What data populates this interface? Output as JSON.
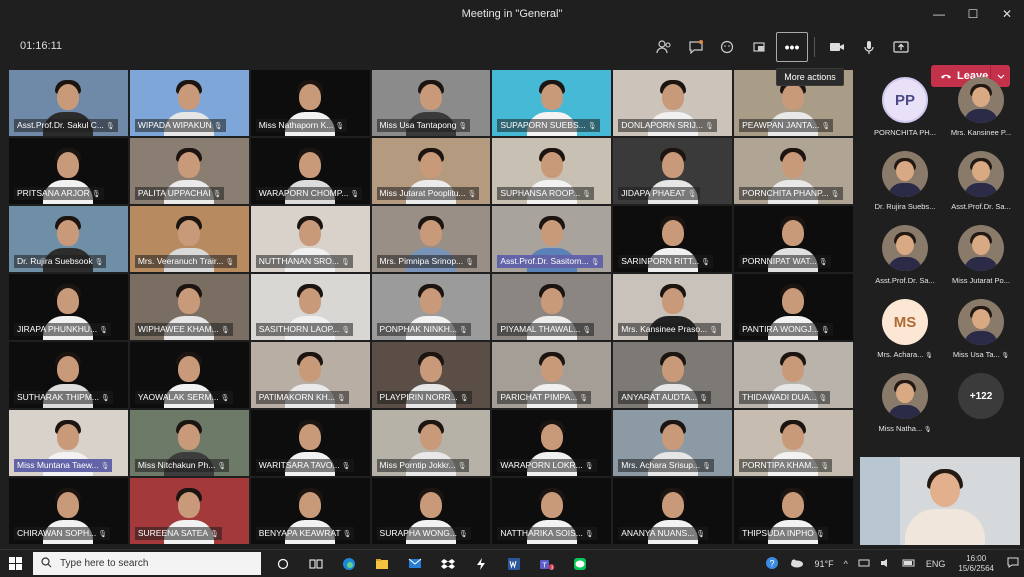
{
  "window": {
    "title": "Meeting in \"General\"",
    "minimize": "—",
    "maximize": "☐",
    "close": "✕"
  },
  "toolbar": {
    "timer": "01:16:11",
    "more_icon": "•••",
    "more_tooltip": "More actions",
    "leave_label": "Leave",
    "icons": [
      "participants-icon",
      "chat-icon",
      "reactions-icon",
      "share-tray-icon",
      "more-actions-icon",
      "camera-icon",
      "mic-icon",
      "share-icon"
    ]
  },
  "participants": [
    {
      "name": "Asst.Prof.Dr. Sakul C...",
      "bg": "#6f8aa8",
      "shirt": "#2b2b2b"
    },
    {
      "name": "WIPADA WIPAKUN",
      "bg": "#7fa6d8",
      "shirt": "#e6e6e6"
    },
    {
      "name": "Miss Nathaporn K...",
      "bg": "#0d0d0d",
      "shirt": "#f2f2f2"
    },
    {
      "name": "Miss Usa Tantapong",
      "bg": "#8b8b8b",
      "shirt": "#3a3a3a"
    },
    {
      "name": "SUPAPORN SUEBS...",
      "bg": "#46b9d6",
      "shirt": "#f3f3f3"
    },
    {
      "name": "DONLAPORN SRIJ...",
      "bg": "#ccc3bb",
      "shirt": "#f0f0f0"
    },
    {
      "name": "PEAWPAN JANTA...",
      "bg": "#aa9d88",
      "shirt": "#e8e8e8"
    },
    {
      "name": "PRITSANA ARJOR",
      "bg": "#0d0d0d",
      "shirt": "#f2f2f2"
    },
    {
      "name": "PALITA UPPACHAI",
      "bg": "#8a7e73",
      "shirt": "#eaeaea"
    },
    {
      "name": "WARAPORN CHOMP...",
      "bg": "#0d0d0d",
      "shirt": "#dcdcdc"
    },
    {
      "name": "Miss Jutarat Pooplitu...",
      "bg": "#b49a7f",
      "shirt": "#ececec"
    },
    {
      "name": "SUPHANSA ROOP...",
      "bg": "#c8c0b3",
      "shirt": "#f2f2f2"
    },
    {
      "name": "JIDAPA PHAEAT",
      "bg": "#3a3a3a",
      "shirt": "#e6e6e6"
    },
    {
      "name": "PORNCHITA PHANP...",
      "bg": "#b0a594",
      "shirt": "#e8e8e8"
    },
    {
      "name": "Dr. Rujira Suebsook",
      "bg": "#6e8fa6",
      "shirt": "#2d2d2d"
    },
    {
      "name": "Mrs. Veeranuch Trair...",
      "bg": "#b78b5f",
      "shirt": "#d9d9d9"
    },
    {
      "name": "NUTTHANAN SRO...",
      "bg": "#d8d2cb",
      "shirt": "#f0f0f0"
    },
    {
      "name": "Mrs. Pimnipa Srinop...",
      "bg": "#9a8f86",
      "shirt": "#7a93b8"
    },
    {
      "name": "Asst.Prof.Dr. Sasitorn...",
      "bg": "#a9a39e",
      "shirt": "#5a82b8",
      "selected": true
    },
    {
      "name": "SARINPORN RITT...",
      "bg": "#0d0d0d",
      "shirt": "#f0f0f0"
    },
    {
      "name": "PORNNIPAT WAT...",
      "bg": "#0d0d0d",
      "shirt": "#e0e0e0"
    },
    {
      "name": "JIRAPA PHUNKHU...",
      "bg": "#0d0d0d",
      "shirt": "#f2f2f2"
    },
    {
      "name": "WIPHAWEE KHAM...",
      "bg": "#7a6e62",
      "shirt": "#e6e6e6"
    },
    {
      "name": "SASITHORN LAOP...",
      "bg": "#d9d7d3",
      "shirt": "#f0f0f0"
    },
    {
      "name": "PONPHAK NINKH...",
      "bg": "#9b9b9b",
      "shirt": "#f2f2f2"
    },
    {
      "name": "PIYAMAL THAWAL...",
      "bg": "#8b8682",
      "shirt": "#ececec"
    },
    {
      "name": "Mrs. Kansinee Praso...",
      "bg": "#c9c2ba",
      "shirt": "#222222"
    },
    {
      "name": "PANTIRA WONGJ...",
      "bg": "#0d0d0d",
      "shirt": "#f2f2f2"
    },
    {
      "name": "SUTHARAK THIPM...",
      "bg": "#0d0d0d",
      "shirt": "#dddddd"
    },
    {
      "name": "YAOWALAK SERM...",
      "bg": "#0d0d0d",
      "shirt": "#f2f2f2"
    },
    {
      "name": "PATIMAKORN KH...",
      "bg": "#b8aea3",
      "shirt": "#eaeaea"
    },
    {
      "name": "PLAYPIRIN NORR...",
      "bg": "#5a4e46",
      "shirt": "#e6e6e6"
    },
    {
      "name": "PARICHAT PIMPA...",
      "bg": "#a59e96",
      "shirt": "#f0f0f0"
    },
    {
      "name": "ANYARAT AUDTA...",
      "bg": "#7d7a76",
      "shirt": "#e6e6e6"
    },
    {
      "name": "THIDAWADI DUA...",
      "bg": "#b9b3ab",
      "shirt": "#e6e6e6"
    },
    {
      "name": "Miss Muntana Taew...",
      "bg": "#d8d2cb",
      "shirt": "#f2f2f2",
      "selected": true
    },
    {
      "name": "Miss Nitchakun Ph...",
      "bg": "#6d7a68",
      "shirt": "#3c3c3c"
    },
    {
      "name": "WARITSARA TAVO...",
      "bg": "#0d0d0d",
      "shirt": "#f2f2f2"
    },
    {
      "name": "Miss Porntip Jokkr...",
      "bg": "#b7b2a7",
      "shirt": "#e8e8e8"
    },
    {
      "name": "WARAPORN LOKR...",
      "bg": "#0d0d0d",
      "shirt": "#f0f0f0"
    },
    {
      "name": "Mrs. Achara Srisup...",
      "bg": "#8b9aa5",
      "shirt": "#e6e6e6"
    },
    {
      "name": "PORNTIPA KHAM...",
      "bg": "#c6bdb0",
      "shirt": "#f2f2f2"
    },
    {
      "name": "CHIRAWAN SOPH...",
      "bg": "#0d0d0d",
      "shirt": "#f2f2f2"
    },
    {
      "name": "SUREENA SATEA",
      "bg": "#a3393b",
      "shirt": "#f2f2f2"
    },
    {
      "name": "BENYAPA KEAWRAT",
      "bg": "#0d0d0d",
      "shirt": "#f2f2f2"
    },
    {
      "name": "SURAPHA WONG...",
      "bg": "#0d0d0d",
      "shirt": "#f2f2f2"
    },
    {
      "name": "NATTHARIKA SOIS...",
      "bg": "#0d0d0d",
      "shirt": "#f2f2f2"
    },
    {
      "name": "ANANYA NUANS...",
      "bg": "#0d0d0d",
      "shirt": "#f2f2f2"
    },
    {
      "name": "THIPSUDA INPHO",
      "bg": "#0d0d0d",
      "shirt": "#f2f2f2"
    }
  ],
  "side_panel": [
    {
      "label": "PORNCHITA PH...",
      "type": "initials",
      "initials": "PP",
      "muted": false
    },
    {
      "label": "Mrs. Kansinee P...",
      "type": "photo",
      "muted": false
    },
    {
      "label": "Dr. Rujira Suebs...",
      "type": "photo",
      "muted": false
    },
    {
      "label": "Asst.Prof.Dr. Sa...",
      "type": "photo",
      "muted": false
    },
    {
      "label": "Asst.Prof.Dr. Sa...",
      "type": "photo",
      "muted": false
    },
    {
      "label": "Miss Jutarat Po...",
      "type": "photo",
      "muted": false
    },
    {
      "label": "Mrs. Achara...",
      "type": "ms",
      "initials": "MS",
      "muted": true
    },
    {
      "label": "Miss Usa Ta...",
      "type": "photo",
      "muted": true
    },
    {
      "label": "Miss Natha...",
      "type": "photo",
      "muted": true
    },
    {
      "label": "",
      "type": "more",
      "initials": "+122",
      "muted": false
    }
  ],
  "taskbar": {
    "search_placeholder": "Type here to search",
    "weather": "91°F",
    "lang": "ENG",
    "time": "16:00",
    "date": "15/6/2564",
    "teams_badge": "3"
  }
}
